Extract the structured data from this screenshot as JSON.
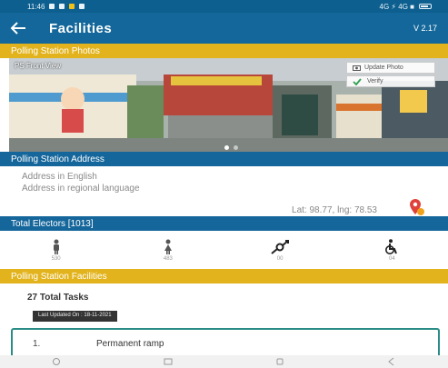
{
  "status_bar": {
    "time": "11:46",
    "right_text": "4G ⚡ 4G ■"
  },
  "app_bar": {
    "title": "Facilities",
    "version": "V 2.17"
  },
  "photos": {
    "section_title": "Polling Station Photos",
    "photo_label": "PS Front View",
    "update_photo_label": "Update Photo",
    "verify_label": "Verify"
  },
  "address": {
    "section_title": "Polling Station Address",
    "line1": "Address in English",
    "line2": "Address in regional language",
    "latlng": "Lat: 98.77, lng: 78.53"
  },
  "electors": {
    "section_title": "Total Electors [1013]",
    "items": [
      {
        "icon": "male-icon",
        "value": "530"
      },
      {
        "icon": "female-icon",
        "value": "483"
      },
      {
        "icon": "third-gender-icon",
        "value": "00"
      },
      {
        "icon": "wheelchair-icon",
        "value": "04"
      }
    ]
  },
  "facilities": {
    "section_title": "Polling Station Facilities",
    "total_tasks": "27 Total Tasks",
    "last_updated": "Last Updated On : 18-11-2021",
    "first_task": {
      "number": "1.",
      "name": "Permanent ramp"
    }
  },
  "colors": {
    "primary": "#13679a",
    "accent": "#e2b31c",
    "card_border": "#2b8c86"
  }
}
